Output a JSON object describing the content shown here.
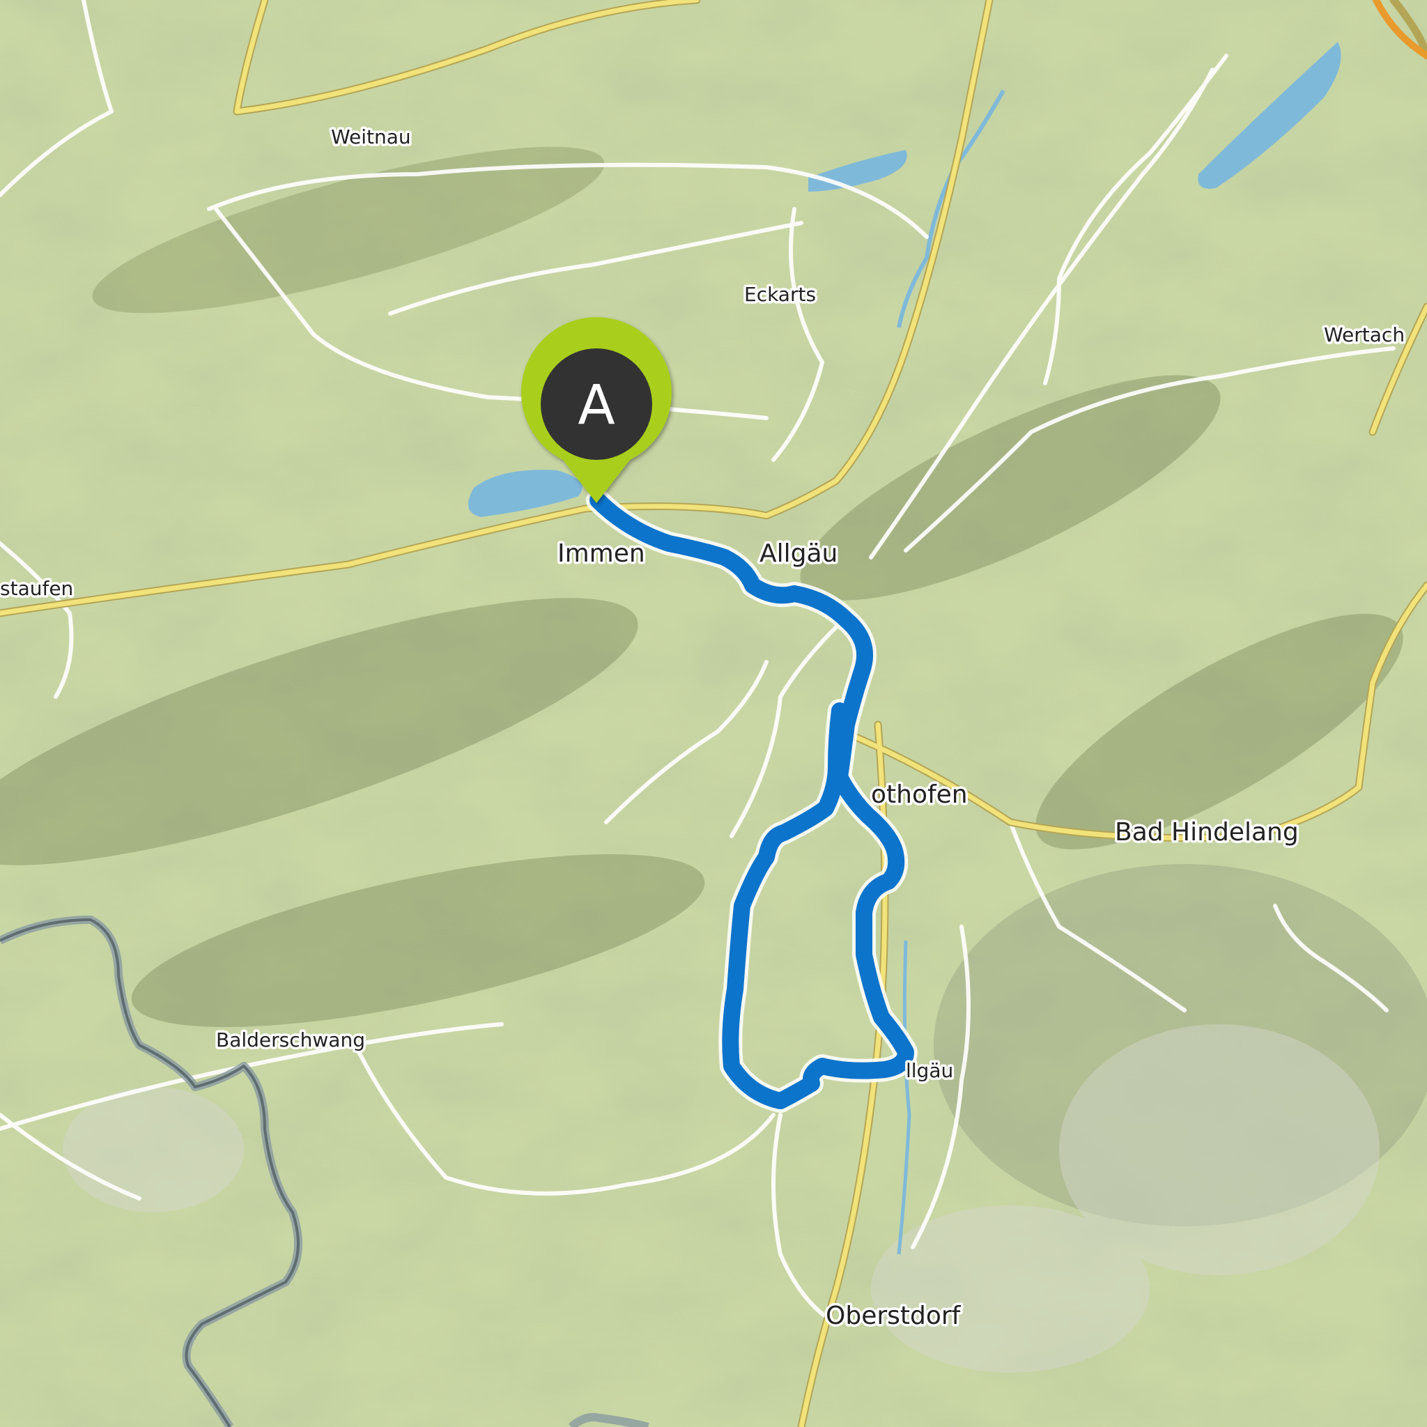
{
  "map": {
    "type": "topographic route map",
    "colors": {
      "terrain": "#c9d7a4",
      "route": "#0d74cc",
      "water": "#7fb9d9",
      "major_road": "#f1e27a",
      "marker_ring": "#a9cf1f",
      "marker_fill": "#333333",
      "border": "#6d7b80"
    }
  },
  "start_marker": {
    "letter": "A",
    "icon": "start-pin-icon"
  },
  "labels": {
    "weitnau": "Weitnau",
    "eckarts": "Eckarts",
    "wertach": "Wertach",
    "staufen": "staufen",
    "immenstadt": "Immen",
    "allgaeu_north": "Allgäu",
    "sonthofen": "othofen",
    "bad_hindelang": "Bad Hindelang",
    "balderschwang": "Balderschwang",
    "allgaeu_south": "llgäu",
    "oberstdorf": "Oberstdorf"
  }
}
